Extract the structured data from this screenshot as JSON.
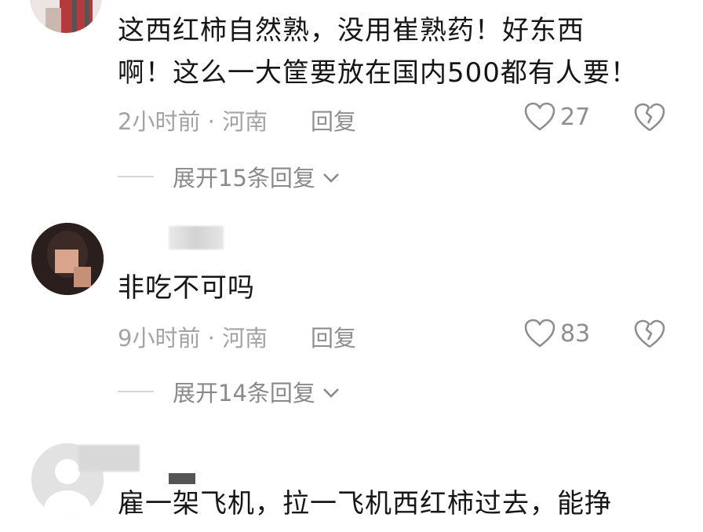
{
  "comments": [
    {
      "text_lines": [
        "这西红柿自然熟，没用崔熟药！好东西",
        "啊！这么一大筐要放在国内500都有人要！"
      ],
      "time": "2小时前 · 河南",
      "reply_label": "回复",
      "likes": "27",
      "expand_label": "展开15条回复"
    },
    {
      "text_lines": [
        "非吃不可吗"
      ],
      "time": "9小时前 · 河南",
      "reply_label": "回复",
      "likes": "83",
      "expand_label": "展开14条回复"
    },
    {
      "text_lines": [
        "雇一架飞机，拉一飞机西红柿过去，能挣"
      ]
    }
  ],
  "icons": {
    "like": "heart-outline-icon",
    "dislike": "broken-heart-icon",
    "expand": "chevron-down-icon"
  },
  "colors": {
    "text": "#161616",
    "meta": "#a3a3a3",
    "icon": "#8e8e8e"
  }
}
